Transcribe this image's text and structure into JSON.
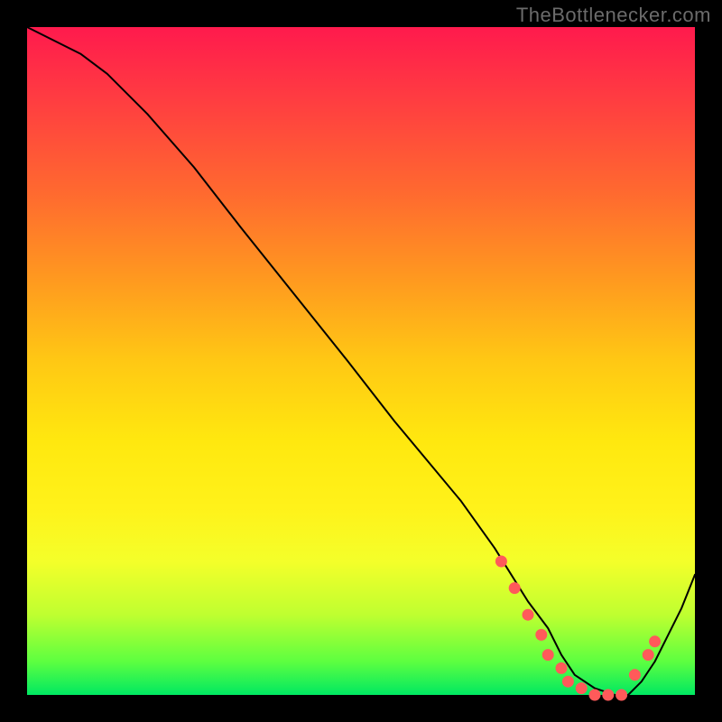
{
  "watermark": "TheBottlenecker.com",
  "chart_data": {
    "type": "line",
    "title": "",
    "xlabel": "",
    "ylabel": "",
    "xlim": [
      0,
      100
    ],
    "ylim": [
      0,
      100
    ],
    "series": [
      {
        "name": "curve",
        "x": [
          0,
          8,
          12,
          18,
          25,
          32,
          40,
          48,
          55,
          60,
          65,
          70,
          75,
          78,
          80,
          82,
          85,
          88,
          90,
          92,
          94,
          96,
          98,
          100
        ],
        "y": [
          100,
          96,
          93,
          87,
          79,
          70,
          60,
          50,
          41,
          35,
          29,
          22,
          14,
          10,
          6,
          3,
          1,
          0,
          0,
          2,
          5,
          9,
          13,
          18
        ]
      }
    ],
    "markers": {
      "name": "highlight-points",
      "x": [
        71,
        73,
        75,
        77,
        78,
        80,
        81,
        83,
        85,
        87,
        89,
        91,
        93,
        94
      ],
      "y": [
        20,
        16,
        12,
        9,
        6,
        4,
        2,
        1,
        0,
        0,
        0,
        3,
        6,
        8
      ]
    }
  }
}
